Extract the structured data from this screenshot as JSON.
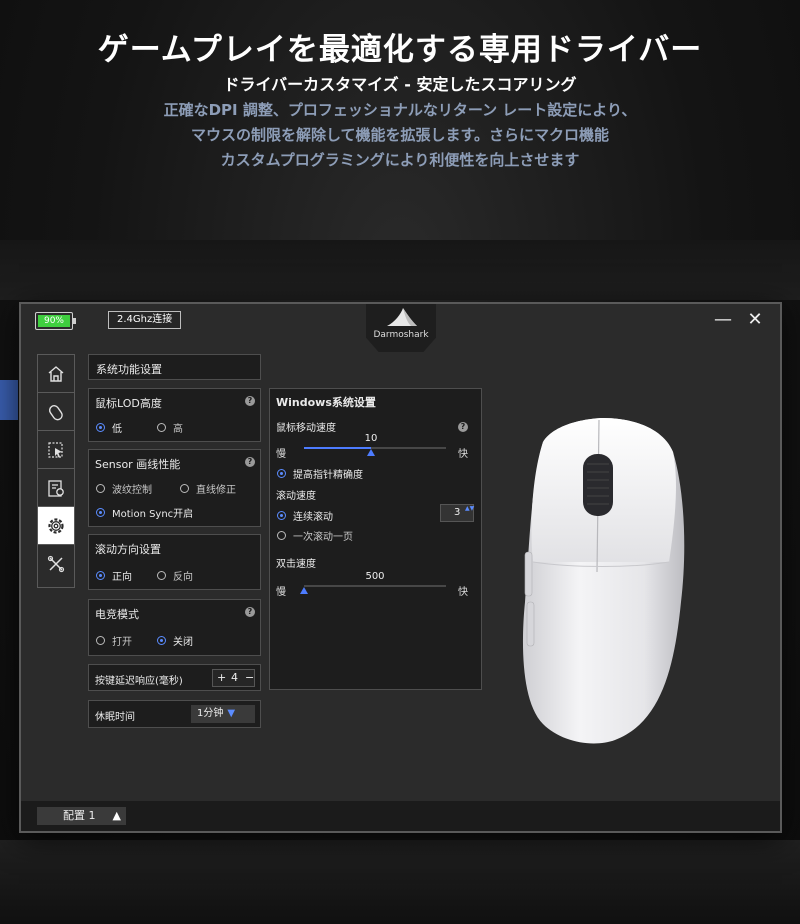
{
  "hero": {
    "title": "ゲームプレイを最適化する専用ドライバー",
    "subtitle": "ドライバーカスタマイズ - 安定したスコアリング",
    "desc_lines": [
      "正確なDPI 調整、プロフェッショナルなリターン レート設定により、",
      "マウスの制限を解除して機能を拡張します。さらにマクロ機能",
      "カスタムプログラミングにより利便性を向上させます"
    ]
  },
  "app": {
    "battery_label": "90%",
    "battery_color": "#3fcf3f",
    "connection": "2.4Ghz连接",
    "brand": "Darmoshark",
    "minimize": "—",
    "close": "✕",
    "nav_icons": [
      "home-icon",
      "mouse-icon",
      "select-icon",
      "macro-icon",
      "gear-icon",
      "tools-icon"
    ],
    "nav_active_index": 4
  },
  "system": {
    "header": "系统功能设置",
    "lod": {
      "title": "鼠标LOD高度",
      "help": "?",
      "options": [
        "低",
        "高"
      ],
      "selected": "低"
    },
    "sensor": {
      "title": "Sensor 画线性能",
      "help": "?",
      "options": [
        "波纹控制",
        "直线修正",
        "Motion Sync开启"
      ],
      "selected": "Motion Sync开启"
    },
    "scroll_dir": {
      "title": "滚动方向设置",
      "options": [
        "正向",
        "反向"
      ],
      "selected": "正向"
    },
    "esports": {
      "title": "电竞模式",
      "help": "?",
      "options": [
        "打开",
        "关闭"
      ],
      "selected": "关闭"
    },
    "debounce": {
      "label": "按键延迟响应(毫秒)",
      "plus": "+",
      "value": "4",
      "minus": "−"
    },
    "sleep": {
      "label": "休眠时间",
      "value": "1分钟",
      "arrow": "▼"
    }
  },
  "windows": {
    "header": "Windows系统设置",
    "pointer_speed": {
      "title": "鼠标移动速度",
      "help": "?",
      "value": "10",
      "min": 1,
      "max": 20,
      "slow": "慢",
      "fast": "快",
      "precision": "提高指针精确度",
      "precision_on": true
    },
    "scroll_speed": {
      "title": "滚动速度",
      "options": [
        "连续滚动",
        "一次滚动一页"
      ],
      "selected": "连续滚动",
      "lines": "3",
      "stepper_glyph": "▲▼"
    },
    "double_click": {
      "title": "双击速度",
      "value": "500",
      "fraction": 0.0,
      "slow": "慢",
      "fast": "快"
    }
  },
  "footer": {
    "profile": "配置 1",
    "profile_arrow": "▲"
  }
}
